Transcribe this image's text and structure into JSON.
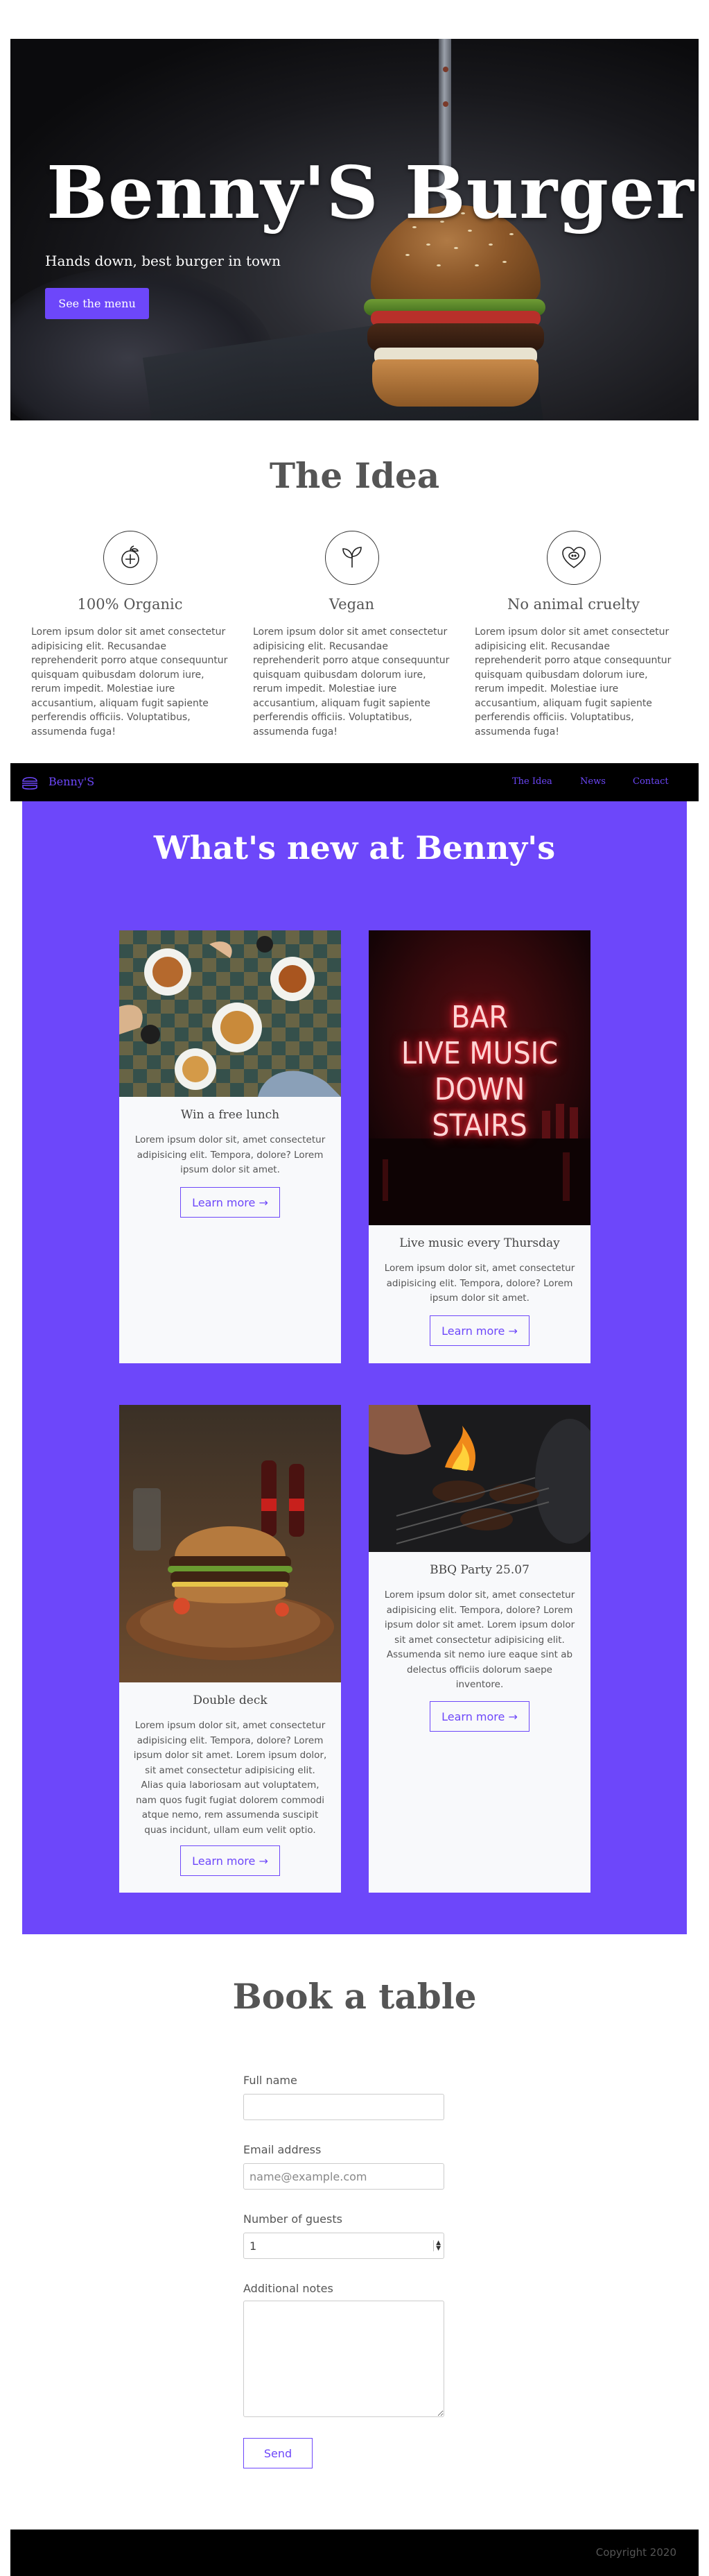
{
  "hero": {
    "title": "Benny'S Burger",
    "tagline": "Hands down, best burger in town",
    "button_label": "See the menu"
  },
  "idea": {
    "title": "The Idea",
    "features": [
      {
        "icon": "fruit-icon",
        "title": "100% Organic",
        "text": "Lorem ipsum dolor sit amet consectetur adipisicing elit. Recusandae reprehenderit porro atque consequuntur quisquam quibusdam dolorum iure, rerum impedit. Molestiae iure accusantium, aliquam fugit sapiente perferendis officiis. Voluptatibus, assumenda fuga!"
      },
      {
        "icon": "leaf-icon",
        "title": "Vegan",
        "text": "Lorem ipsum dolor sit amet consectetur adipisicing elit. Recusandae reprehenderit porro atque consequuntur quisquam quibusdam dolorum iure, rerum impedit. Molestiae iure accusantium, aliquam fugit sapiente perferendis officiis. Voluptatibus, assumenda fuga!"
      },
      {
        "icon": "heart-pig-icon",
        "title": "No animal cruelty",
        "text": "Lorem ipsum dolor sit amet consectetur adipisicing elit. Recusandae reprehenderit porro atque consequuntur quisquam quibusdam dolorum iure, rerum impedit. Molestiae iure accusantium, aliquam fugit sapiente perferendis officiis. Voluptatibus, assumenda fuga!"
      }
    ]
  },
  "navbar": {
    "brand": "Benny'S",
    "links": [
      "The Idea",
      "News",
      "Contact"
    ]
  },
  "news": {
    "title": "What's new at Benny's",
    "cards": [
      {
        "title": "Win a free lunch",
        "text": "Lorem ipsum dolor sit, amet consectetur adipisicing elit. Tempora, dolore? Lorem ipsum dolor sit amet.",
        "button": "Learn more →"
      },
      {
        "title": "Live music every Thursday",
        "text": "Lorem ipsum dolor sit, amet consectetur adipisicing elit. Tempora, dolore? Lorem ipsum dolor sit amet.",
        "button": "Learn more →",
        "sign_lines": [
          "BAR",
          "LIVE MUSIC",
          "DOWN",
          "STAIRS"
        ]
      },
      {
        "title": "Double deck",
        "text": "Lorem ipsum dolor sit, amet consectetur adipisicing elit. Tempora, dolore? Lorem ipsum dolor sit amet. Lorem ipsum dolor, sit amet consectetur adipisicing elit. Alias quia laboriosam aut voluptatem, nam quos fugit fugiat dolorem commodi atque nemo, rem assumenda suscipit quas incidunt, ullam eum velit optio.",
        "button": "Learn more →"
      },
      {
        "title": "BBQ Party 25.07",
        "text": "Lorem ipsum dolor sit, amet consectetur adipisicing elit. Tempora, dolore? Lorem ipsum dolor sit amet. Lorem ipsum dolor sit amet consectetur adipisicing elit. Assumenda sit nemo iure eaque sint ab delectus officiis dolorum saepe inventore.",
        "button": "Learn more →"
      }
    ]
  },
  "booking": {
    "title": "Book a table",
    "full_name_label": "Full name",
    "full_name_value": "",
    "email_label": "Email address",
    "email_placeholder": "name@example.com",
    "guests_label": "Number of guests",
    "guests_value": "1",
    "notes_label": "Additional notes",
    "send_label": "Send"
  },
  "footer": {
    "copyright": "Copyright 2020"
  },
  "colors": {
    "accent": "#6d47fa",
    "dark": "#000000",
    "card_bg": "#f8f9fb"
  }
}
